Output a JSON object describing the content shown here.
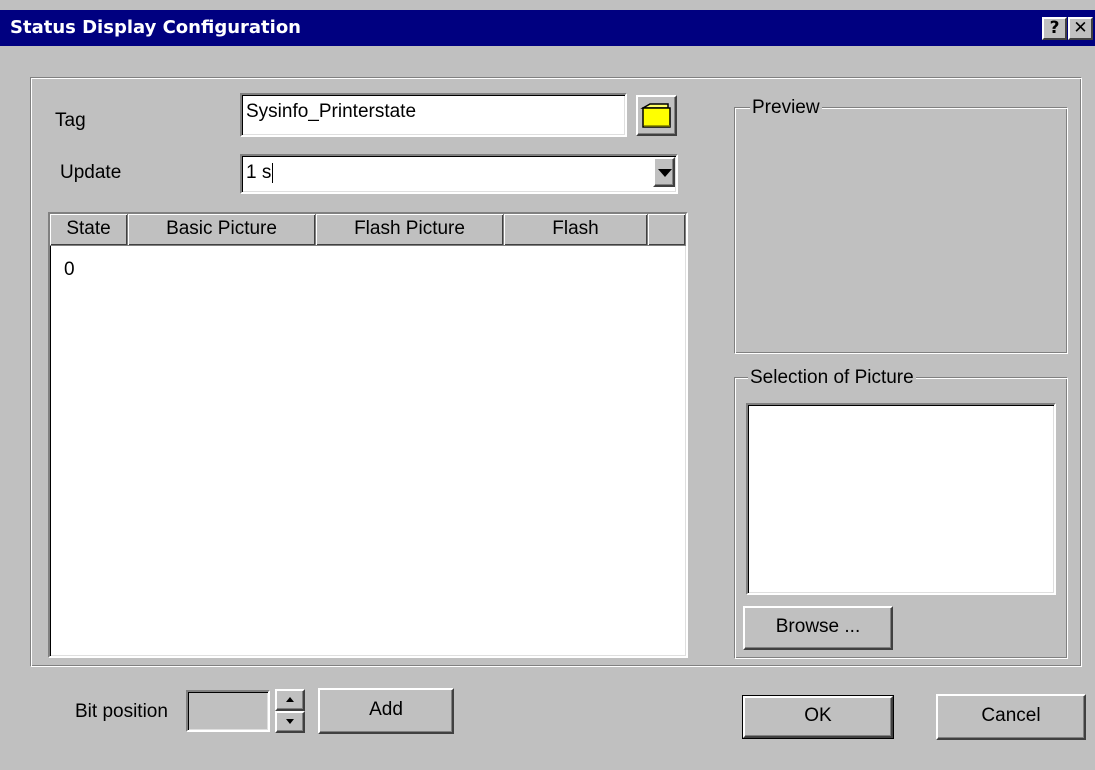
{
  "window": {
    "title": "Status Display Configuration",
    "help_label": "?",
    "close_label": "✕"
  },
  "form": {
    "tag_label": "Tag",
    "tag_value": "Sysinfo_Printerstate",
    "update_label": "Update",
    "update_value": "1 s"
  },
  "table": {
    "columns": [
      "State",
      "Basic Picture",
      "Flash Picture",
      "Flash"
    ],
    "rows": [
      {
        "state": "0",
        "basic_picture": "",
        "flash_picture": "",
        "flash": ""
      }
    ]
  },
  "preview": {
    "legend": "Preview"
  },
  "selection": {
    "legend": "Selection of Picture",
    "browse_label": "Browse ..."
  },
  "bottom": {
    "bit_position_label": "Bit position",
    "bit_position_value": "",
    "add_label": "Add",
    "ok_label": "OK",
    "cancel_label": "Cancel"
  },
  "icons": {
    "folder": "folder-icon",
    "dropdown": "chevron-down-icon",
    "spin_up": "spin-up-icon",
    "spin_down": "spin-down-icon"
  }
}
